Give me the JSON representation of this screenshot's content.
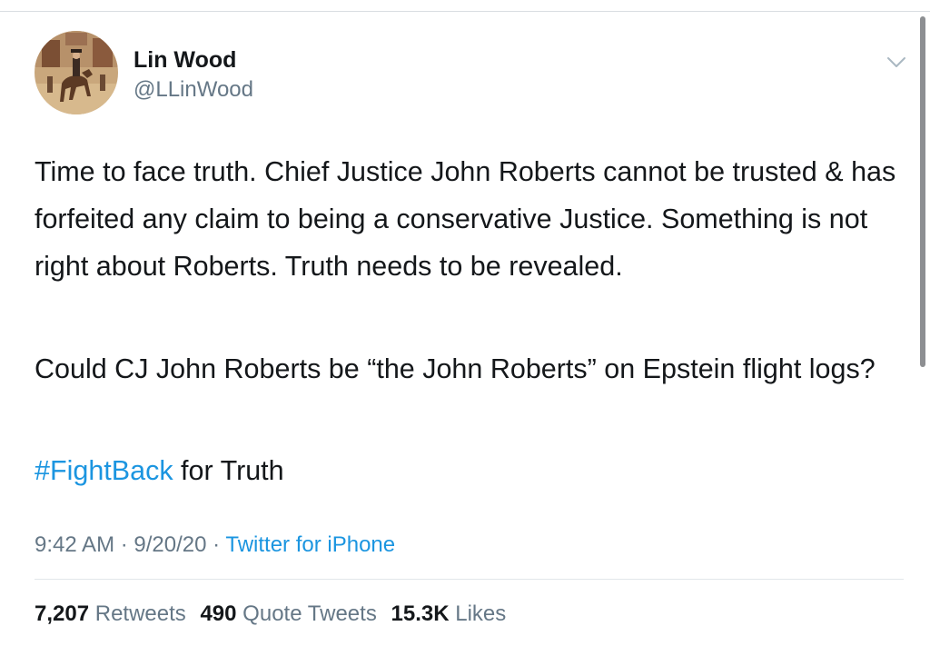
{
  "tweet": {
    "author_name": "Lin Wood",
    "author_handle": "@LLinWood",
    "paragraph_1": "Time to face truth. Chief Justice John Roberts cannot be trusted & has forfeited any claim to being a conservative Justice. Something is not right about Roberts. Truth needs to be revealed.",
    "paragraph_2": "Could CJ John Roberts be “the John Roberts” on Epstein flight logs?",
    "hashtag": "#FightBack",
    "hashtag_suffix": " for Truth",
    "time": "9:42 AM",
    "date": "9/20/20",
    "separator": " · ",
    "source": "Twitter for iPhone"
  },
  "stats": {
    "retweets_count": "7,207",
    "retweets_label": "Retweets",
    "quote_count": "490",
    "quote_label": "Quote Tweets",
    "likes_count": "15.3K",
    "likes_label": "Likes"
  },
  "icons": {
    "menu": "chevron-down-icon",
    "avatar": "horse-rider-avatar"
  },
  "colors": {
    "link": "#1b95e0",
    "secondary_text": "#657786",
    "primary_text": "#14171a",
    "divider": "#e1e6ea"
  }
}
